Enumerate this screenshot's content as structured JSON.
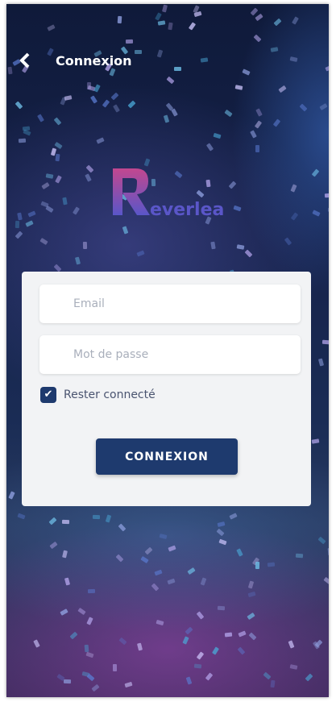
{
  "header": {
    "title": "Connexion",
    "back_icon": "chevron-left-icon"
  },
  "logo": {
    "text": "everleaf",
    "letter": "R"
  },
  "form": {
    "email_placeholder": "Email",
    "password_placeholder": "Mot de passe",
    "remember_label": "Rester connecté",
    "remember_checked": true,
    "submit_label": "CONNEXION"
  },
  "colors": {
    "primary": "#1e3a6e",
    "card": "#f2f3f5",
    "logo_gradient": [
      "#c2478f",
      "#5a56c8"
    ]
  }
}
